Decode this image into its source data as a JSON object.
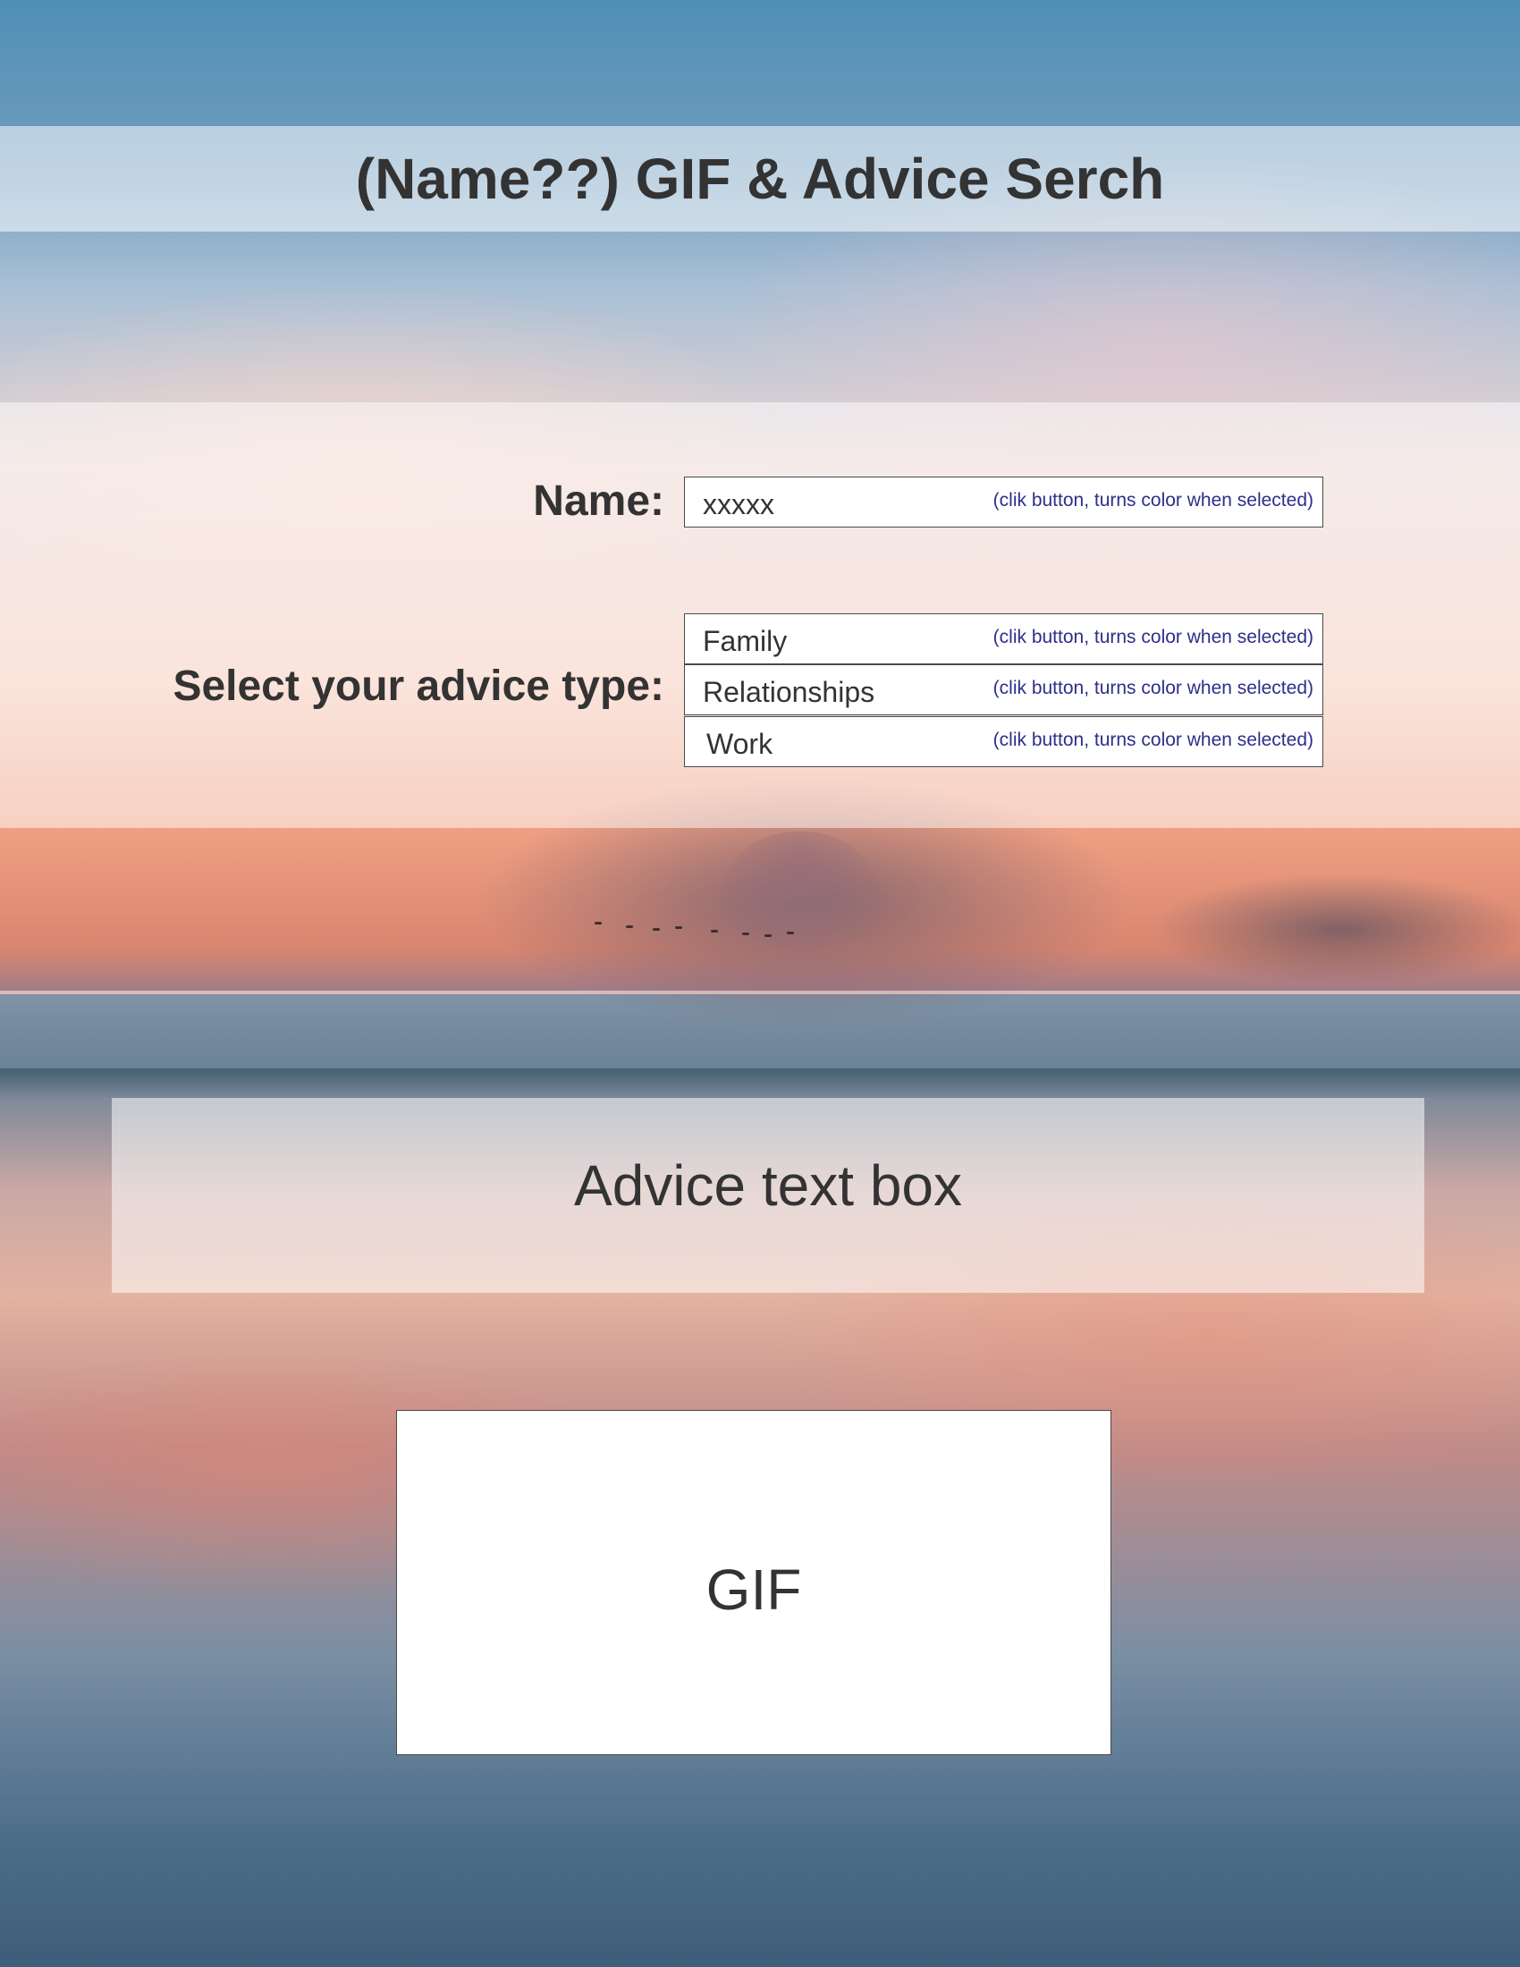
{
  "header": {
    "title": "(Name??) GIF & Advice Serch"
  },
  "form": {
    "name_label": "Name:",
    "name_value": "xxxxx",
    "name_hint": "(clik button, turns color when selected)",
    "advice_type_label": "Select your advice type:",
    "advice_options": [
      {
        "label": "Family",
        "hint": "(clik button, turns color when selected)"
      },
      {
        "label": "Relationships",
        "hint": "(clik button, turns color when selected)"
      },
      {
        "label": "Work",
        "hint": "(clik button, turns color when selected)"
      }
    ]
  },
  "advice": {
    "text": "Advice text box"
  },
  "gif": {
    "text": "GIF"
  },
  "colors": {
    "text": "#333333",
    "hint": "#2e2f8a",
    "field_border": "#4a4a4a"
  }
}
